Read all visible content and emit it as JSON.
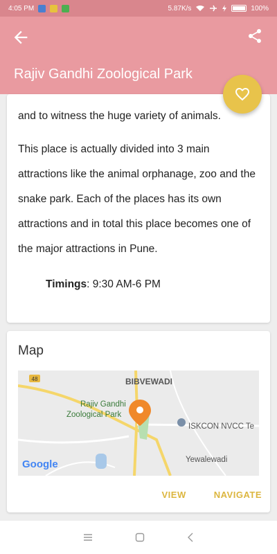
{
  "status_bar": {
    "time": "4:05 PM",
    "network_speed": "5.87K/s",
    "battery": "100%"
  },
  "app_bar": {
    "title": "Rajiv Gandhi Zoological Park",
    "back_icon": "arrow-back-icon",
    "share_icon": "share-icon"
  },
  "fab": {
    "icon": "heart-outline-icon"
  },
  "description": {
    "first_line": "and to witness the huge variety of animals.",
    "paragraph": "This place is actually divided into 3 main attractions like the animal orphanage, zoo and the snake park. Each of the places has its own attractions and in total this place becomes one of the major attractions in Pune.",
    "timings_label": "Timings",
    "timings_value": ": 9:30 AM-6 PM"
  },
  "map": {
    "title": "Map",
    "labels": {
      "area": "BIBVEWADI",
      "park_line1": "Rajiv Gandhi",
      "park_line2": "Zoological Park",
      "temple": "ISKCON NVCC Te",
      "locality": "Yewalewadi",
      "highway": "48",
      "google": "Google"
    },
    "view_label": "VIEW",
    "navigate_label": "NAVIGATE"
  },
  "colors": {
    "app_bar": "#e99aa0",
    "status_bar": "#d9868d",
    "fab": "#e8c34b",
    "accent_text": "#dcb63f",
    "marker": "#f0892a"
  }
}
